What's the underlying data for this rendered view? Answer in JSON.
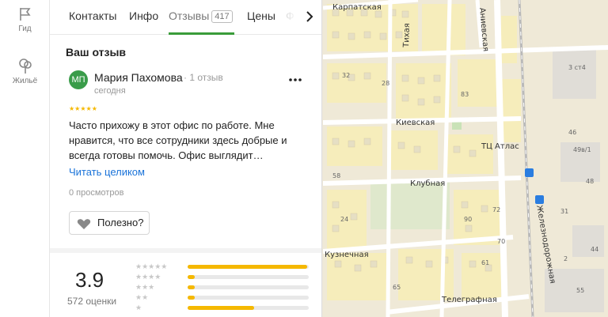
{
  "rail": {
    "items": [
      {
        "label": "Гид",
        "icon": "flag-icon"
      },
      {
        "label": "Жильё",
        "icon": "tree-icon"
      }
    ]
  },
  "tabs": [
    {
      "label": "Контакты"
    },
    {
      "label": "Инфо"
    },
    {
      "label": "Отзывы",
      "count": "417",
      "active": true
    },
    {
      "label": "Цены"
    },
    {
      "label": "Ф"
    }
  ],
  "review": {
    "section_title": "Ваш отзыв",
    "avatar_initials": "МП",
    "author": "Мария Пахомова",
    "author_meta": "· 1 отзыв",
    "date": "сегодня",
    "rating": 5,
    "text": "Часто прихожу в этот офис по работе. Мне нравится, что все сотрудники здесь добрые и всегда готовы помочь. Офис выглядит…",
    "read_more": "Читать целиком",
    "views": "0 просмотров",
    "useful_label": "Полезно?"
  },
  "summary": {
    "rating_value": "3.9",
    "rating_count": "572 оценки",
    "distribution": [
      {
        "stars": 5,
        "fraction": 0.99
      },
      {
        "stars": 4,
        "fraction": 0.06
      },
      {
        "stars": 3,
        "fraction": 0.06
      },
      {
        "stars": 2,
        "fraction": 0.06
      },
      {
        "stars": 1,
        "fraction": 0.55
      }
    ]
  },
  "map": {
    "streets": [
      "Карпатская",
      "Тихая",
      "Киевская",
      "Клубная",
      "Кузнечная",
      "Телеграфная",
      "Железнодорожная",
      "Аниевская"
    ],
    "places": [
      "ТЦ Атлас"
    ],
    "house_numbers": [
      "32",
      "28",
      "83",
      "58",
      "24",
      "90",
      "72",
      "70",
      "65",
      "61",
      "3 ст4",
      "46",
      "49в/1",
      "48",
      "31",
      "44",
      "2",
      "55"
    ]
  },
  "colors": {
    "accent_green": "#3a9c3a",
    "star_yellow": "#f5b800",
    "link_blue": "#1a73d9"
  }
}
